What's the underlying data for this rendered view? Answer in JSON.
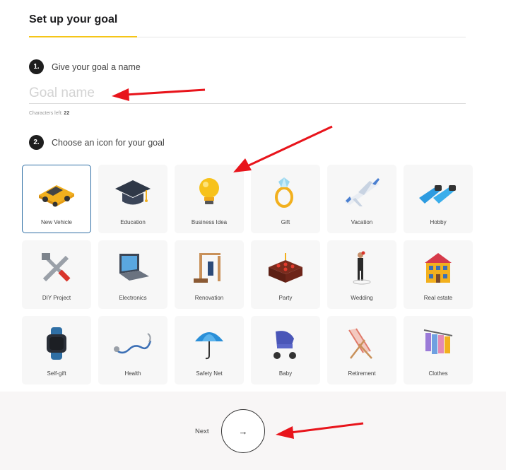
{
  "header": {
    "title": "Set up your goal"
  },
  "step1": {
    "number": "1.",
    "label": "Give your goal a name",
    "placeholder": "Goal name",
    "chars_label": "Characters left:",
    "chars_left": "22"
  },
  "step2": {
    "number": "2.",
    "label": "Choose an icon for your goal"
  },
  "icons": [
    {
      "label": "New Vehicle",
      "icon": "car-icon",
      "selected": true
    },
    {
      "label": "Education",
      "icon": "graduation-cap-icon"
    },
    {
      "label": "Business Idea",
      "icon": "lightbulb-icon"
    },
    {
      "label": "Gift",
      "icon": "ring-icon"
    },
    {
      "label": "Vacation",
      "icon": "airplane-icon"
    },
    {
      "label": "Hobby",
      "icon": "flippers-icon"
    },
    {
      "label": "DIY Project",
      "icon": "tools-icon"
    },
    {
      "label": "Electronics",
      "icon": "laptop-icon"
    },
    {
      "label": "Renovation",
      "icon": "renovation-icon"
    },
    {
      "label": "Party",
      "icon": "cake-icon"
    },
    {
      "label": "Wedding",
      "icon": "wedding-icon"
    },
    {
      "label": "Real estate",
      "icon": "house-icon"
    },
    {
      "label": "Self-gift",
      "icon": "smartwatch-icon"
    },
    {
      "label": "Health",
      "icon": "stethoscope-icon"
    },
    {
      "label": "Safety Net",
      "icon": "umbrella-icon"
    },
    {
      "label": "Baby",
      "icon": "stroller-icon"
    },
    {
      "label": "Retirement",
      "icon": "deck-chair-icon"
    },
    {
      "label": "Clothes",
      "icon": "clothes-rack-icon"
    }
  ],
  "footer": {
    "next_label": "Next",
    "next_icon": "→"
  },
  "colors": {
    "accent": "#f5c518",
    "selected_border": "#2f6fa5",
    "annotation_arrow": "#e8141b"
  }
}
